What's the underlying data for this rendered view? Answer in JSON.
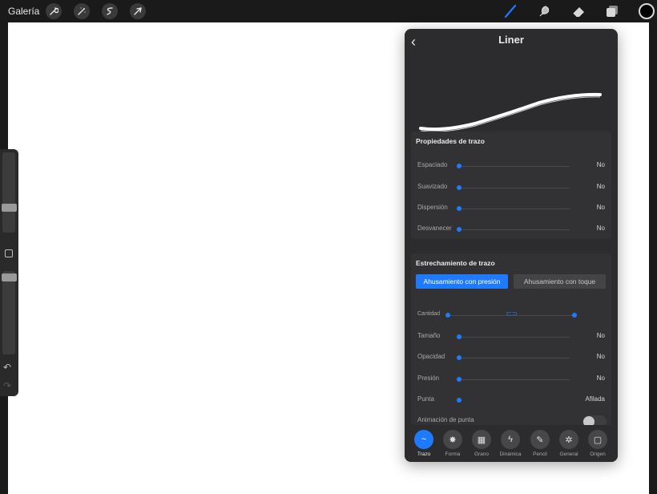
{
  "topbar": {
    "gallery_label": "Galería",
    "left_tools": [
      "wrench-icon",
      "magic-wand-icon",
      "selection-icon",
      "transform-icon"
    ],
    "right_tools": [
      "brush-icon",
      "smudge-icon",
      "eraser-icon",
      "layers-icon"
    ],
    "current_color": "#000000",
    "accent": "#1e7bff"
  },
  "panel": {
    "title": "Liner",
    "back_icon": "chevron-left-icon",
    "stroke_properties": {
      "title": "Propiedades de trazo",
      "rows": [
        {
          "label": "Espaciado",
          "value": "No"
        },
        {
          "label": "Suavizado",
          "value": "No"
        },
        {
          "label": "Dispersión",
          "value": "No"
        },
        {
          "label": "Desvanecer",
          "value": "No"
        }
      ]
    },
    "taper": {
      "title": "Estrechamiento de trazo",
      "seg_active": "Ahusamiento con presión",
      "seg_inactive": "Ahusamiento con toque",
      "amount_label": "Cantidad",
      "rows": [
        {
          "label": "Tamaño",
          "value": "No"
        },
        {
          "label": "Opacidad",
          "value": "No"
        },
        {
          "label": "Presión",
          "value": "No"
        },
        {
          "label": "Punta",
          "value": "Afilada"
        }
      ],
      "tip_animation_label": "Animación de punta"
    },
    "tabs": [
      {
        "label": "Trazo",
        "icon": "~",
        "active": true
      },
      {
        "label": "Forma",
        "icon": "✸",
        "active": false
      },
      {
        "label": "Grano",
        "icon": "▦",
        "active": false
      },
      {
        "label": "Dinámica",
        "icon": "ϟ",
        "active": false
      },
      {
        "label": "Pencil",
        "icon": "✎",
        "active": false
      },
      {
        "label": "General",
        "icon": "✲",
        "active": false
      },
      {
        "label": "Origen",
        "icon": "▢",
        "active": false
      }
    ]
  }
}
